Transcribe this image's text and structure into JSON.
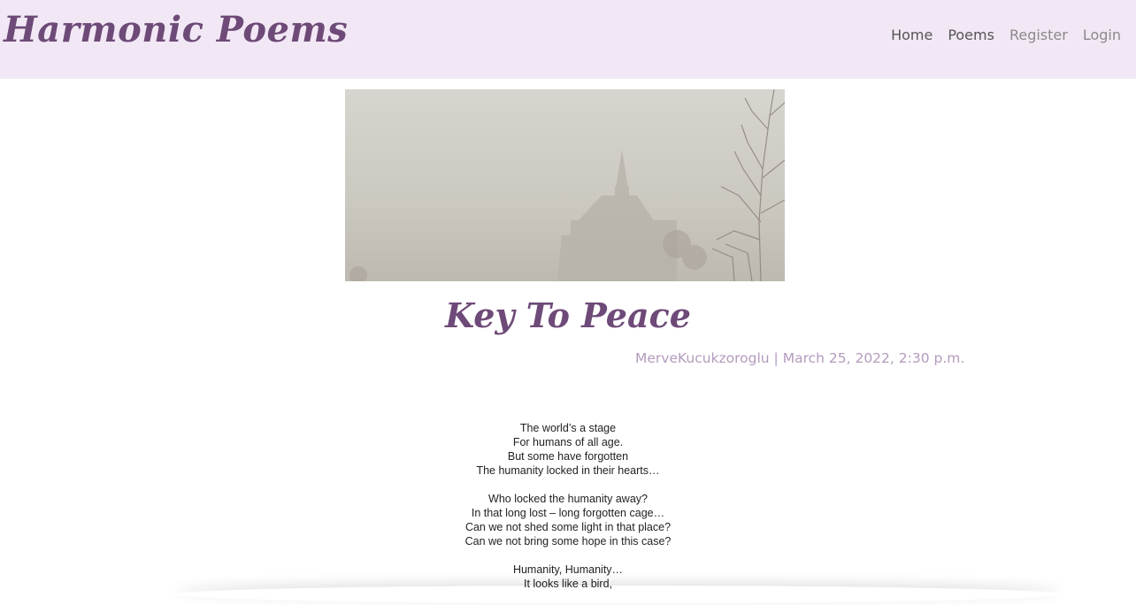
{
  "brand": {
    "title": "Harmonic Poems"
  },
  "nav": {
    "items": [
      {
        "label": "Home"
      },
      {
        "label": "Poems"
      },
      {
        "label": "Register"
      },
      {
        "label": "Login"
      }
    ]
  },
  "poem": {
    "title": "Key To Peace",
    "meta": "MerveKucukzoroglu | March 25, 2022, 2:30 p.m.",
    "stanzas": [
      [
        "The world’s a stage",
        "For humans of all age.",
        "But some have forgotten",
        "The humanity locked in their hearts…"
      ],
      [
        "Who locked the humanity away?",
        "In that long lost – long forgotten cage…",
        "Can we not shed some light in that place?",
        "Can we not bring some hope in this case?"
      ],
      [
        "Humanity, Humanity…",
        "It looks like a bird,"
      ]
    ]
  },
  "colors": {
    "navbar_bg": "#f2e8f5",
    "brand": "#6e4a78",
    "meta": "#b39bbd"
  }
}
